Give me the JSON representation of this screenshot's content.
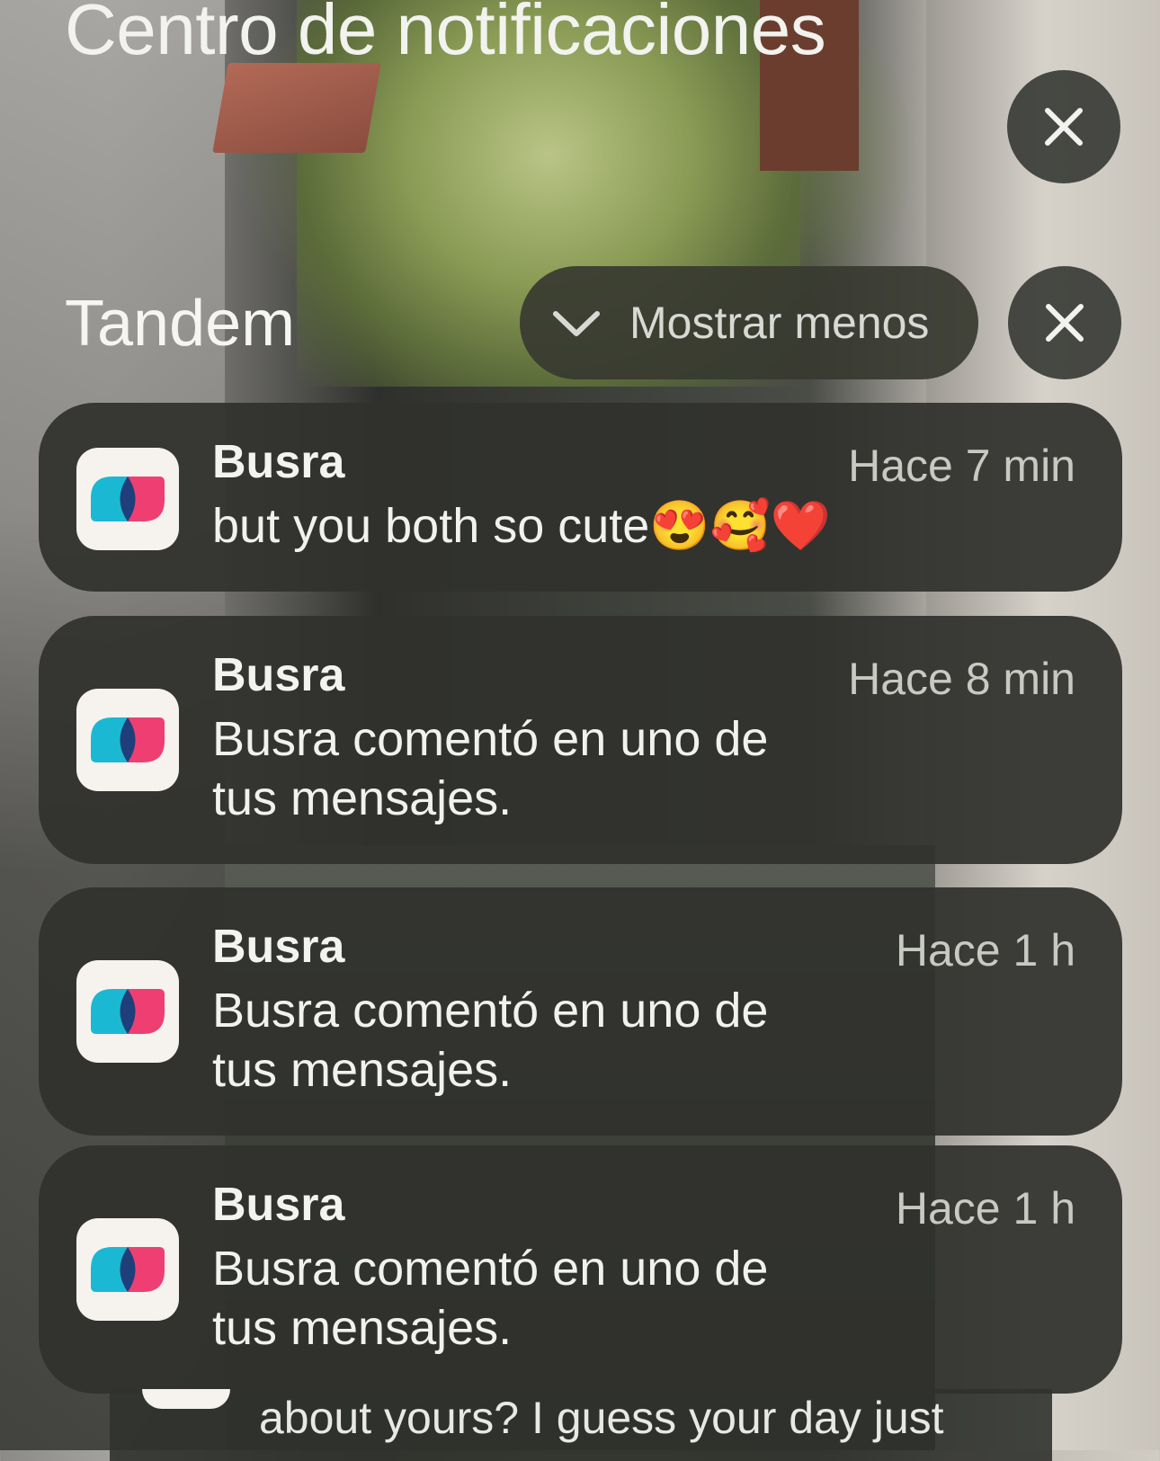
{
  "header": {
    "title": "Centro de notificaciones"
  },
  "group": {
    "app_name": "Tandem",
    "show_less_label": "Mostrar menos"
  },
  "notifications": [
    {
      "sender": "Busra",
      "time": "Hace 7 min",
      "message": "but you both so cute😍🥰❤️"
    },
    {
      "sender": "Busra",
      "time": "Hace 8 min",
      "message": "Busra comentó en uno de tus mensajes."
    },
    {
      "sender": "Busra",
      "time": "Hace 1 h",
      "message": "Busra comentó en uno de tus mensajes."
    },
    {
      "sender": "Busra",
      "time": "Hace 1 h",
      "message": "Busra comentó en uno de tus mensajes."
    }
  ],
  "peek": {
    "message": "about yours? I guess your day just"
  },
  "colors": {
    "tandem_teal": "#1bb8d3",
    "tandem_pink": "#ef3f72",
    "tandem_navy": "#1f3f7a"
  }
}
